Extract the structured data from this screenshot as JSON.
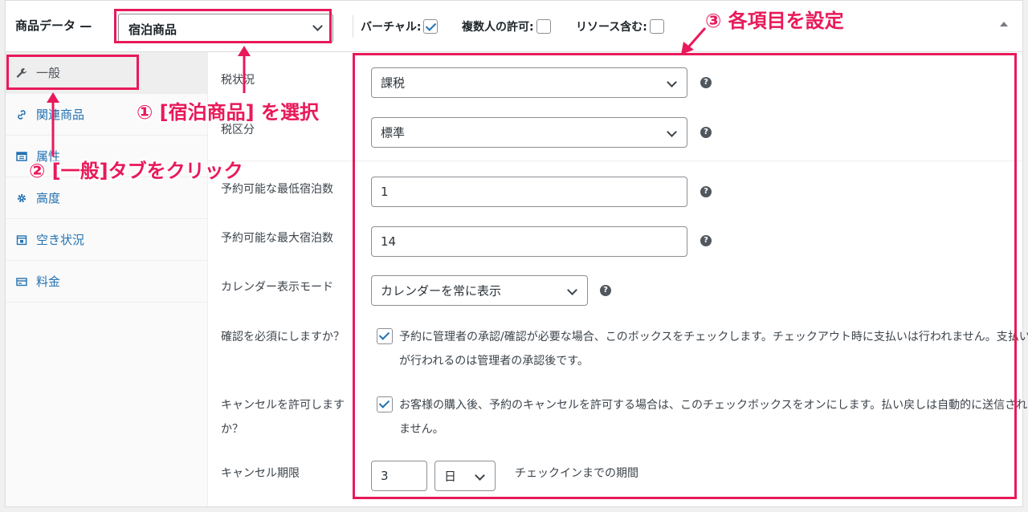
{
  "header": {
    "title": "商品データ —",
    "product_type": "宿泊商品",
    "options": [
      {
        "label": "バーチャル:",
        "checked": true
      },
      {
        "label": "複数人の許可:",
        "checked": false
      },
      {
        "label": "リソース含む:",
        "checked": false
      }
    ]
  },
  "sidebar": {
    "tabs": [
      {
        "label": "一般",
        "icon": "wrench-icon",
        "active": true
      },
      {
        "label": "関連商品",
        "icon": "link-icon"
      },
      {
        "label": "属性",
        "icon": "table-icon"
      },
      {
        "label": "高度",
        "icon": "gear-icon"
      },
      {
        "label": "空き状況",
        "icon": "calendar-icon"
      },
      {
        "label": "料金",
        "icon": "money-icon"
      }
    ]
  },
  "form": {
    "tax_status": {
      "label": "税状況",
      "value": "課税"
    },
    "tax_class": {
      "label": "税区分",
      "value": "標準"
    },
    "min_nights": {
      "label": "予約可能な最低宿泊数",
      "value": "1"
    },
    "max_nights": {
      "label": "予約可能な最大宿泊数",
      "value": "14"
    },
    "calendar_mode": {
      "label": "カレンダー表示モード",
      "value": "カレンダーを常に表示"
    },
    "requires_confirmation": {
      "label": "確認を必須にしますか？",
      "description": "予約に管理者の承認/確認が必要な場合、このボックスをチェックします。チェックアウト時に支払いは行われません。支払いが行われるのは管理者の承認後です。"
    },
    "allow_cancellation": {
      "label": "キャンセルを許可しますか？",
      "description": "お客様の購入後、予約のキャンセルを許可する場合は、このチェックボックスをオンにします。払い戻しは自動的に送信されません。"
    },
    "cancel_limit": {
      "label": "キャンセル期限",
      "value": "3",
      "unit": "日",
      "suffix": "チェックインまでの期間"
    }
  },
  "annotations": {
    "step1": "① [宿泊商品] を選択",
    "step2": "② [一般]タブをクリック",
    "step3": "③ 各項目を設定",
    "color": "#e8195a"
  }
}
